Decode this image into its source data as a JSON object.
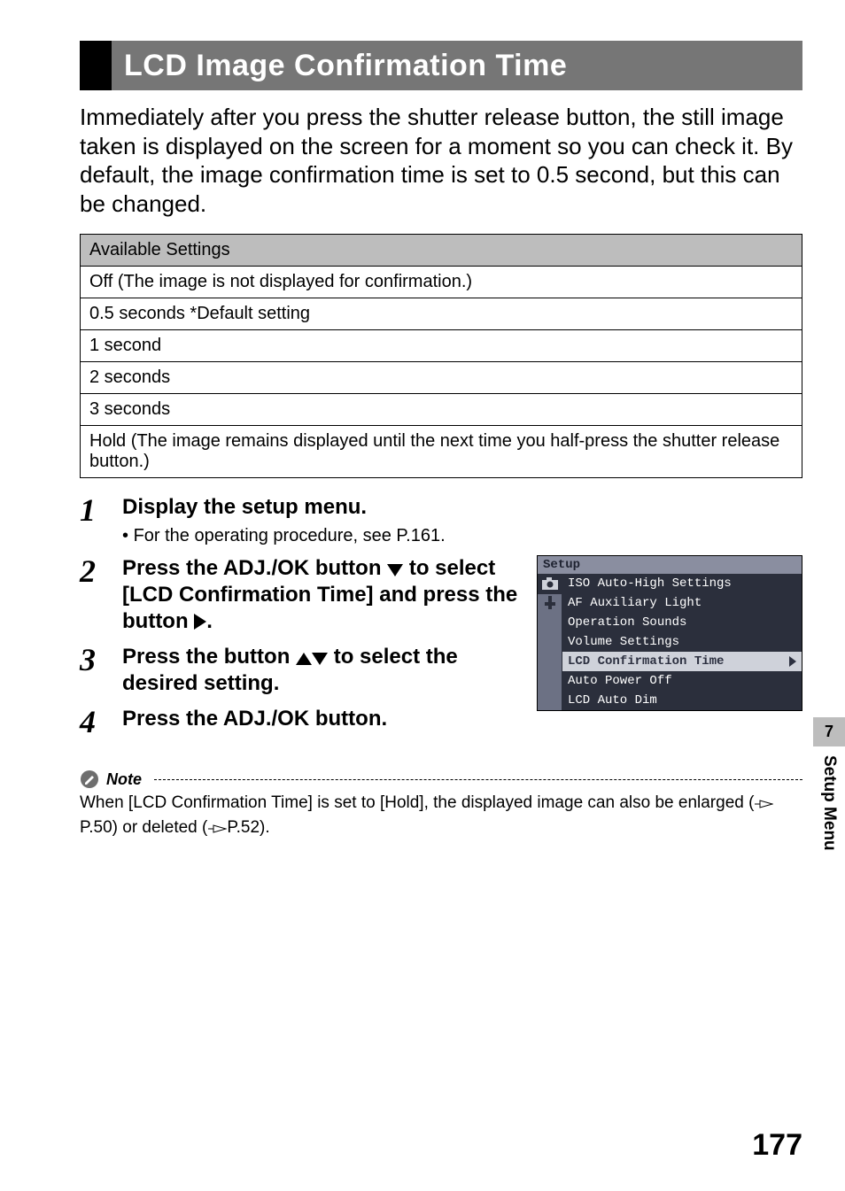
{
  "section": {
    "title": "LCD Image Confirmation Time"
  },
  "intro": "Immediately after you press the shutter release button, the still image taken is displayed on the screen for a moment so you can check it. By default, the image confirmation time is set to 0.5 second, but this can be changed.",
  "settings": {
    "header": "Available Settings",
    "rows": [
      "Off (The image is not displayed for confirmation.)",
      "0.5 seconds *Default setting",
      "1 second",
      "2 seconds",
      "3 seconds",
      "Hold (The image remains displayed until the next time you half-press the shutter release button.)"
    ]
  },
  "steps": {
    "s1": {
      "num": "1",
      "title": "Display the setup menu.",
      "bullet": "For the operating procedure, see P.161."
    },
    "s2": {
      "num": "2",
      "title_a": "Press the ADJ./OK button ",
      "title_b": " to select [LCD Confirmation Time] and press the button ",
      "title_c": "."
    },
    "s3": {
      "num": "3",
      "title_a": "Press the button ",
      "title_b": " to select the desired setting."
    },
    "s4": {
      "num": "4",
      "title": "Press the ADJ./OK button."
    }
  },
  "lcd": {
    "title": "Setup",
    "items": [
      "ISO Auto-High Settings",
      "AF Auxiliary Light",
      "Operation Sounds",
      "Volume Settings",
      "LCD Confirmation Time",
      "Auto Power Off",
      "LCD Auto Dim"
    ],
    "highlight_index": 4
  },
  "note": {
    "label": "Note",
    "text_a": "When [LCD Confirmation Time] is set to [Hold], the displayed image can also be enlarged (",
    "ref1": "P.50",
    "mid": ") or deleted (",
    "ref2": "P.52",
    "text_b": ")."
  },
  "sidetab": {
    "index": "7",
    "label": "Setup Menu"
  },
  "page_number": "177"
}
